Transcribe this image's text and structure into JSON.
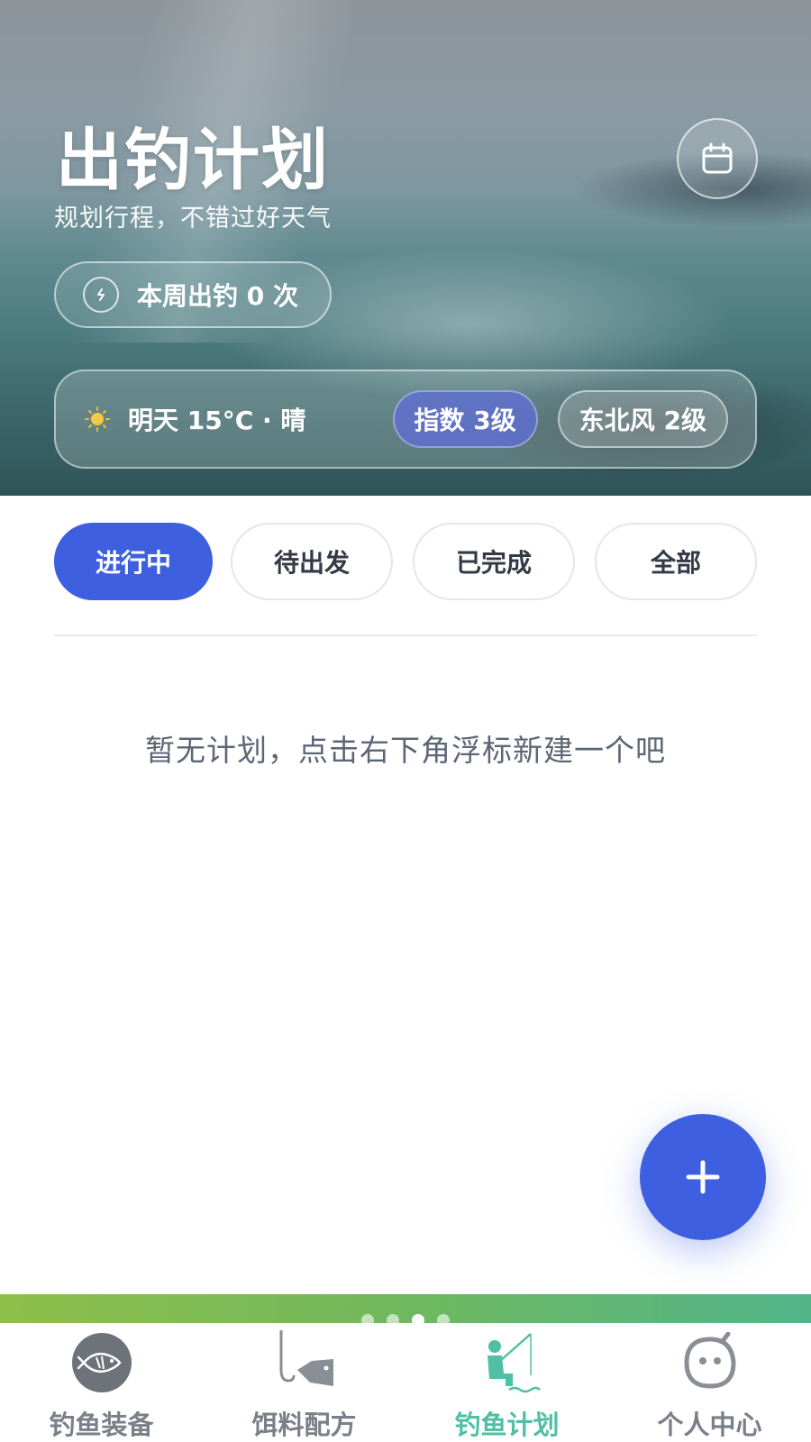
{
  "hero": {
    "title": "出钓计划",
    "subtitle": "规划行程，不错过好天气",
    "week_trips": "本周出钓 0 次",
    "weather": {
      "summary": "明天 15°C · 晴",
      "index": "指数 3级",
      "wind": "东北风 2级"
    }
  },
  "tabs": [
    "进行中",
    "待出发",
    "已完成",
    "全部"
  ],
  "active_tab": "进行中",
  "empty_message": "暂无计划，点击右下角浮标新建一个吧",
  "bottom_nav": {
    "items": [
      {
        "label": "钓鱼装备",
        "icon": "fish-icon"
      },
      {
        "label": "饵料配方",
        "icon": "hook-bait-icon"
      },
      {
        "label": "钓鱼计划",
        "icon": "fisherman-icon"
      },
      {
        "label": "个人中心",
        "icon": "face-icon"
      }
    ],
    "active": "钓鱼计划"
  },
  "colors": {
    "accent": "#3d5fe0",
    "nav_active": "#4fbfa5"
  }
}
